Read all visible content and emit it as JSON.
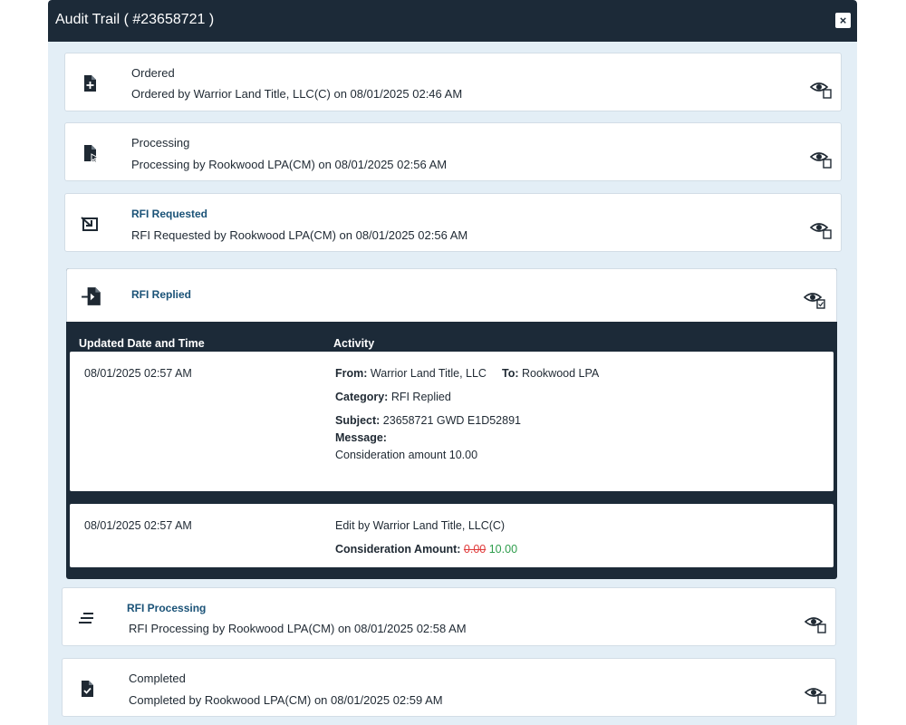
{
  "modal": {
    "title": "Audit Trail ( #23658721 )",
    "close_label": "×"
  },
  "events": [
    {
      "title": "Ordered",
      "desc": "Ordered by Warrior Land Title, LLC(C) on 08/01/2025 02:46 AM",
      "icon": "file-plus-icon"
    },
    {
      "title": "Processing",
      "desc": "Processing by Rookwood LPA(CM) on 08/01/2025 02:56 AM",
      "icon": "file-cursor-icon"
    },
    {
      "title": "RFI Requested",
      "desc": "RFI Requested by Rookwood LPA(CM) on 08/01/2025 02:56 AM",
      "icon": "request-icon"
    },
    {
      "title": "RFI Replied",
      "desc": "",
      "icon": "file-import-icon"
    },
    {
      "title": "RFI Processing",
      "desc": "RFI Processing by Rookwood LPA(CM) on 08/01/2025 02:58 AM",
      "icon": "lines-icon"
    },
    {
      "title": "Completed",
      "desc": "Completed by Rookwood LPA(CM) on 08/01/2025 02:59 AM",
      "icon": "file-check-icon"
    }
  ],
  "detail": {
    "columns": [
      "Updated Date and Time",
      "Activity"
    ],
    "rows": [
      {
        "datetime": "08/01/2025 02:57 AM",
        "from_label": "From:",
        "from_value": "Warrior Land Title, LLC",
        "to_label": "To:",
        "to_value": "Rookwood LPA",
        "category_label": "Category:",
        "category_value": "RFI Replied",
        "subject_label": "Subject:",
        "subject_value": "23658721 GWD E1D52891",
        "message_label": "Message:",
        "message_value": "Consideration amount 10.00"
      },
      {
        "datetime": "08/01/2025 02:57 AM",
        "edit_text": "Edit by Warrior Land Title, LLC(C)",
        "amount_label": "Consideration Amount:",
        "old_value": "0.00",
        "new_value": "10.00"
      }
    ]
  },
  "colors": {
    "header_bg": "#1c2a38",
    "panel_bg": "#e3eef6",
    "link": "#1a5277",
    "old": "#e03b3b",
    "new": "#2e9d4c"
  }
}
